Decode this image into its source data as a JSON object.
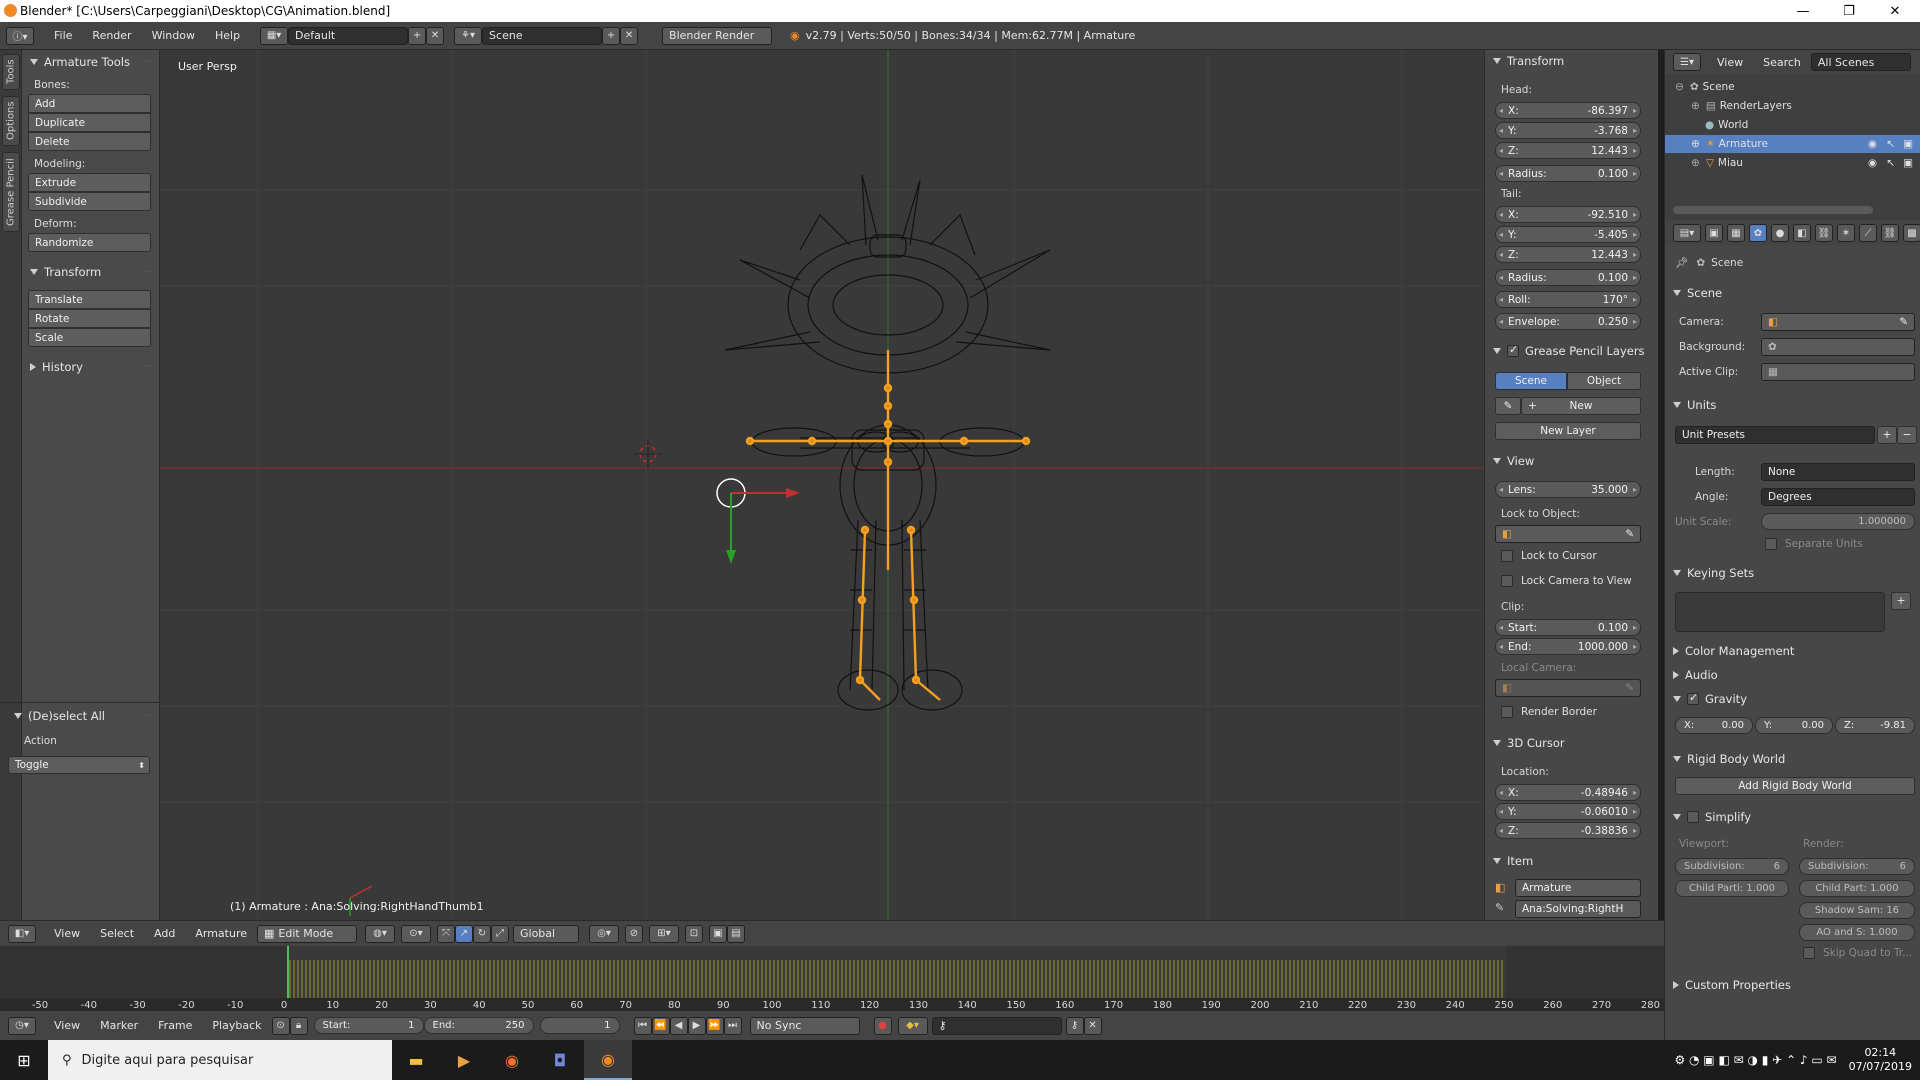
{
  "window": {
    "title": "Blender* [C:\\Users\\Carpeggiani\\Desktop\\CG\\Animation.blend]",
    "controls": [
      "—",
      "❐",
      "✕"
    ]
  },
  "infobar": {
    "menus": [
      "File",
      "Render",
      "Window",
      "Help"
    ],
    "layout": "Default",
    "scene": "Scene",
    "engine": "Blender Render",
    "stats": "v2.79 | Verts:50/50 | Bones:34/34 | Mem:62.77M | Armature"
  },
  "tabs": [
    "Tools",
    "Options",
    "Grease Pencil"
  ],
  "toolshelf": {
    "armature_tools": "Armature Tools",
    "bones_label": "Bones:",
    "bones": [
      "Add",
      "Duplicate",
      "Delete"
    ],
    "modeling_label": "Modeling:",
    "modeling": [
      "Extrude",
      "Subdivide"
    ],
    "deform_label": "Deform:",
    "deform": [
      "Randomize"
    ],
    "transform_head": "Transform",
    "transform": [
      "Translate",
      "Rotate",
      "Scale"
    ],
    "history": "History",
    "deselect_head": "(De)select All",
    "action_label": "Action",
    "action_value": "Toggle"
  },
  "viewport": {
    "persp_label": "User Persp",
    "status": "(1) Armature : Ana:Solving:RightHandThumb1"
  },
  "npanel": {
    "transform": "Transform",
    "head": "Head:",
    "head_x": "-86.397",
    "head_y": "-3.768",
    "head_z": "12.443",
    "head_radius": "0.100",
    "tail": "Tail:",
    "tail_x": "-92.510",
    "tail_y": "-5.405",
    "tail_z": "12.443",
    "tail_radius": "0.100",
    "roll": "170°",
    "envelope": "0.250",
    "grease_pencil": "Grease Pencil Layers",
    "gp_scene": "Scene",
    "gp_object": "Object",
    "gp_new": "New",
    "gp_new_layer": "New Layer",
    "view": "View",
    "lens_label": "Lens:",
    "lens": "35.000",
    "lock_to_object": "Lock to Object:",
    "lock_to_cursor": "Lock to Cursor",
    "lock_camera": "Lock Camera to View",
    "clip": "Clip:",
    "clip_start": "0.100",
    "clip_end": "1000.000",
    "local_camera": "Local Camera:",
    "render_border": "Render Border",
    "cursor": "3D Cursor",
    "location": "Location:",
    "cursor_x": "-0.48946",
    "cursor_y": "-0.06010",
    "cursor_z": "-0.38836",
    "item": "Item",
    "item_name": "Armature",
    "bone_name": "Ana:Solving:RightH"
  },
  "outliner": {
    "view": "View",
    "search": "Search",
    "filter": "All Scenes",
    "rows": [
      "Scene",
      "RenderLayers",
      "World",
      "Armature",
      "Miau"
    ]
  },
  "properties": {
    "breadcrumb": "Scene",
    "scene_head": "Scene",
    "camera": "Camera:",
    "background": "Background:",
    "active_clip": "Active Clip:",
    "units_head": "Units",
    "unit_presets": "Unit Presets",
    "length_label": "Length:",
    "length": "None",
    "angle_label": "Angle:",
    "angle": "Degrees",
    "unit_scale_label": "Unit Scale:",
    "unit_scale": "1.000000",
    "separate_units": "Separate Units",
    "keying_sets": "Keying Sets",
    "color_management": "Color Management",
    "audio": "Audio",
    "gravity": "Gravity",
    "gx": "0.00",
    "gy": "0.00",
    "gz": "-9.81",
    "rigid_body": "Rigid Body World",
    "add_rigid": "Add Rigid Body World",
    "simplify": "Simplify",
    "viewport": "Viewport:",
    "render": "Render:",
    "subdivision": "Subdivision:",
    "subdiv_v": "6",
    "subdiv_r": "6",
    "child_part": "Child Parti: 1.000",
    "child_part_r": "Child Part: 1.000",
    "shadow": "Shadow Sam: 16",
    "ao": "AO and S: 1.000",
    "skip_quad": "Skip Quad to Tr...",
    "custom_props": "Custom Properties"
  },
  "viewheader": {
    "menus": [
      "View",
      "Select",
      "Add",
      "Armature"
    ],
    "mode": "Edit Mode",
    "orientation": "Global"
  },
  "timeline": {
    "ticks": [
      "-50",
      "-40",
      "-30",
      "-20",
      "-10",
      "0",
      "10",
      "20",
      "30",
      "40",
      "50",
      "60",
      "70",
      "80",
      "90",
      "100",
      "110",
      "120",
      "130",
      "140",
      "150",
      "160",
      "170",
      "180",
      "190",
      "200",
      "210",
      "220",
      "230",
      "240",
      "250",
      "260",
      "270",
      "280"
    ],
    "menus": [
      "View",
      "Marker",
      "Frame",
      "Playback"
    ],
    "start_label": "Start:",
    "start": "1",
    "end_label": "End:",
    "end": "250",
    "current": "1",
    "sync": "No Sync"
  },
  "taskbar": {
    "search_placeholder": "Digite aqui para pesquisar",
    "time": "02:14",
    "date": "07/07/2019"
  },
  "colors": {
    "bone_orange": "#f5a020",
    "selected_blue": "#5680c2",
    "axis_red": "#c03030",
    "axis_green": "#2aa02a"
  }
}
